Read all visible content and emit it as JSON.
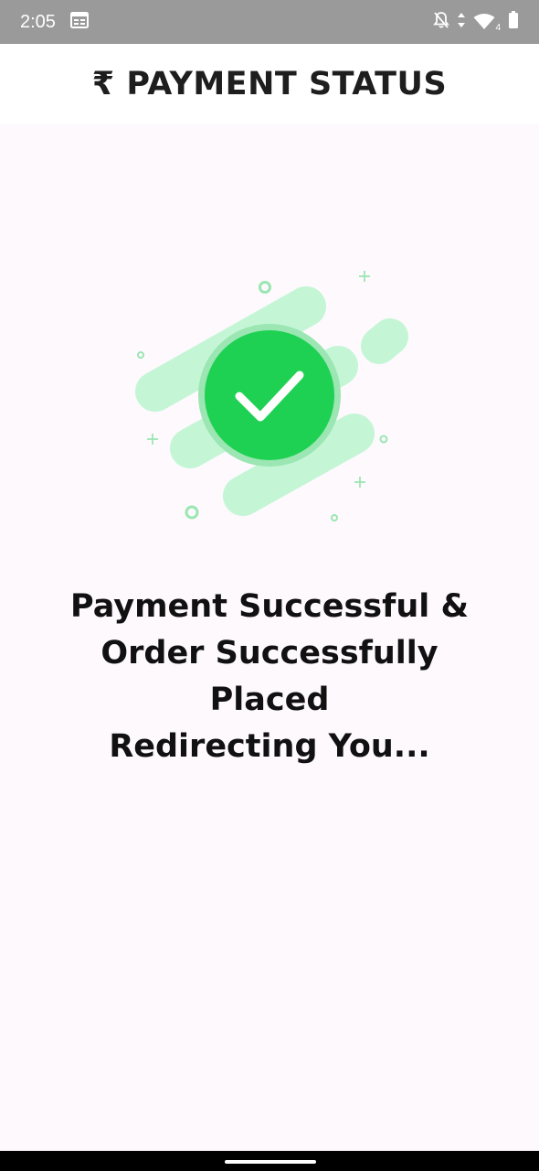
{
  "status_bar": {
    "time": "2:05",
    "network_label": "4",
    "icons": [
      "calendar-icon",
      "notifications-off-icon",
      "data-arrows-icon",
      "wifi-icon",
      "battery-icon"
    ]
  },
  "header": {
    "title": "₹ PAYMENT STATUS"
  },
  "status": {
    "lines": [
      "Payment Successful &",
      "Order Successfully",
      "Placed",
      "Redirecting You..."
    ]
  },
  "colors": {
    "success_green": "#1ed152",
    "decor_green": "#c4f6d6",
    "ring_green": "#9be6b2",
    "status_bar": "#9a9a9a",
    "page_bg": "#fdf9fd"
  }
}
